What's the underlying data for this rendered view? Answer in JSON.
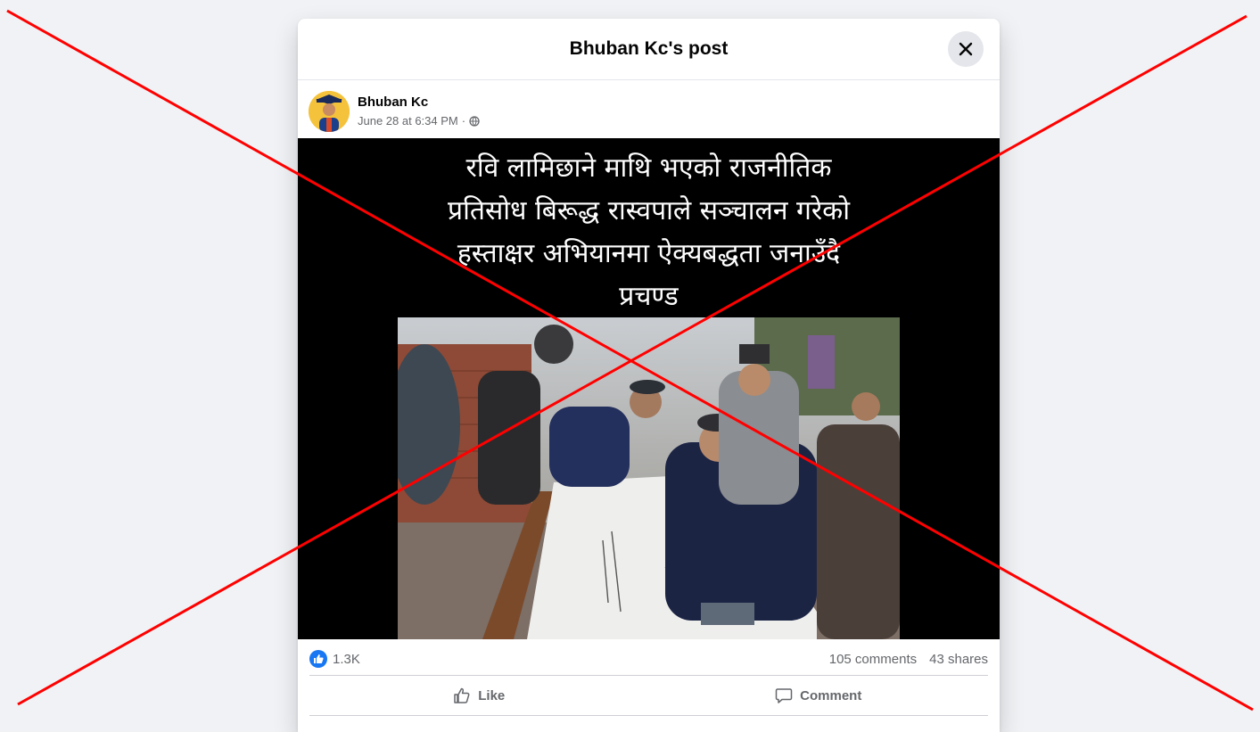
{
  "modal": {
    "title": "Bhuban Kc's post",
    "close_icon": "close-icon"
  },
  "post": {
    "author": "Bhuban Kc",
    "timestamp": "June 28 at 6:34 PM",
    "separator": "·",
    "privacy_icon": "globe-icon",
    "image_caption_lines": [
      "रवि लामिछाने माथि भएको राजनीतिक",
      "प्रतिसोध बिरूद्ध रास्वपाले सञ्चालन गरेको",
      "हस्ताक्षर अभियानमा ऐक्यबद्धता जनाउँदै",
      "प्रचण्ड"
    ]
  },
  "stats": {
    "reaction_icon": "like-reaction-icon",
    "reaction_count": "1.3K",
    "comments": "105 comments",
    "shares": "43 shares"
  },
  "actions": {
    "like_label": "Like",
    "comment_label": "Comment"
  },
  "colors": {
    "page_bg": "#f0f2f5",
    "accent": "#1877f2",
    "cross_overlay": "#ff0000"
  }
}
